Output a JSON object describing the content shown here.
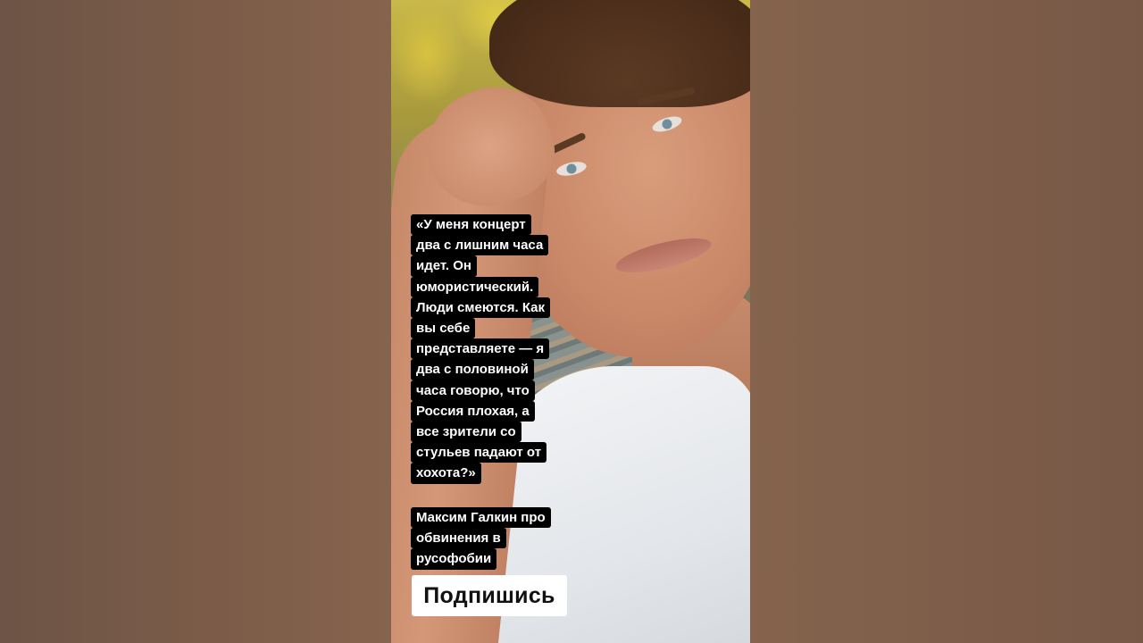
{
  "quote": {
    "lines": [
      "«У меня концерт",
      "два с лишним часа",
      "идет. Он",
      "юмористический.",
      "Люди смеются. Как",
      "вы себе",
      "представляете — я",
      "два с половиной",
      "часа говорю, что",
      "Россия плохая, а",
      "все зрители со",
      "стульев падают от",
      "хохота?»"
    ]
  },
  "byline": {
    "lines": [
      "Максим Галкин про",
      "обвинения в",
      "русофобии"
    ]
  },
  "subscribe_label": "Подпишись"
}
